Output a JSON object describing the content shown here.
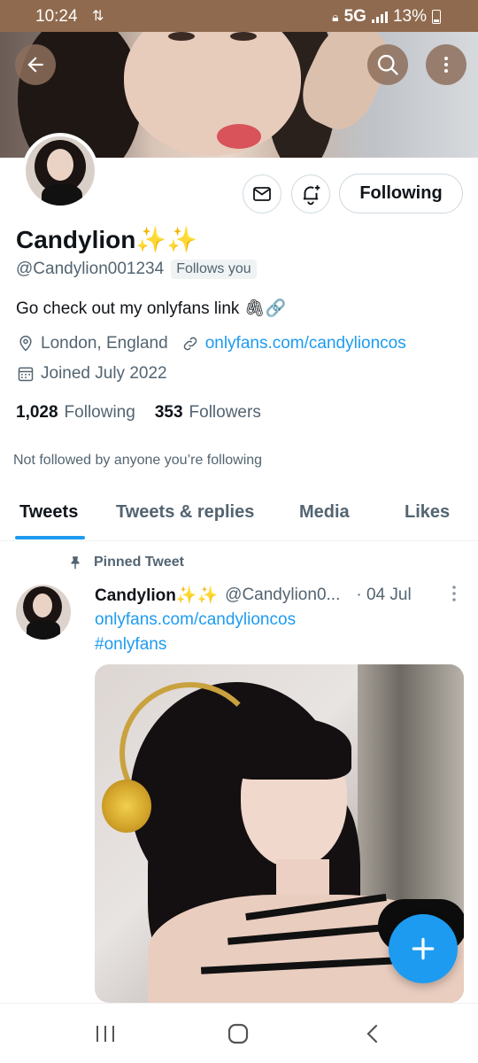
{
  "status_bar": {
    "time": "10:24",
    "network": "5G",
    "battery": "13%"
  },
  "profile": {
    "name": "Candylion✨✨",
    "handle": "@Candylion001234",
    "follows_you": "Follows you",
    "bio": "Go check out my onlyfans link 🖇🔗",
    "location": "London, England",
    "website": "onlyfans.com/candylioncos",
    "joined": "Joined July 2022",
    "following_count": "1,028",
    "following_label": "Following",
    "followers_count": "353",
    "followers_label": "Followers",
    "not_followed": "Not followed by anyone you’re following"
  },
  "actions": {
    "following_button": "Following"
  },
  "tabs": [
    {
      "label": "Tweets",
      "active": true
    },
    {
      "label": "Tweets & replies",
      "active": false
    },
    {
      "label": "Media",
      "active": false
    },
    {
      "label": "Likes",
      "active": false
    }
  ],
  "tweet": {
    "pinned_label": "Pinned Tweet",
    "name": "Candylion✨✨",
    "handle": "@Candylion0...",
    "date": "· 04 Jul",
    "link": "onlyfans.com/candylioncos",
    "hashtag": "#onlyfans"
  },
  "colors": {
    "accent": "#1d9bf0",
    "status_bar": "#8f6a4e",
    "text_secondary": "#536471"
  },
  "icons": [
    "back-arrow-icon",
    "search-icon",
    "more-vertical-icon",
    "mail-icon",
    "bell-plus-icon",
    "location-icon",
    "link-icon",
    "calendar-icon",
    "pin-icon",
    "compose-plus-icon",
    "recents-icon",
    "home-icon",
    "back-nav-icon"
  ]
}
